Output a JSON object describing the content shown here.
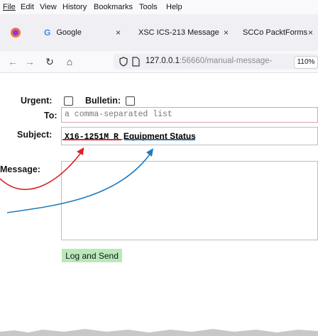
{
  "menu": {
    "file": "File",
    "edit": "Edit",
    "view": "View",
    "history": "History",
    "bookmarks": "Bookmarks",
    "tools": "Tools",
    "help": "Help"
  },
  "tabs": [
    {
      "label": "Google"
    },
    {
      "label": "XSC ICS-213 Message"
    },
    {
      "label": "SCCo PacktForms"
    }
  ],
  "url": {
    "host": "127.0.0.1",
    "rest": ":56660/manual-message-",
    "zoom": "110%"
  },
  "form": {
    "urgent_label": "Urgent:",
    "bulletin_label": "Bulletin:",
    "to_label": "To:",
    "to_placeholder": "a comma-separated list",
    "subject_label": "Subject:",
    "subject_code": "X16-1251M_R_",
    "subject_text": "Equipment Status",
    "message_label": "Message:",
    "send_label": "Log and Send"
  },
  "colors": {
    "red_arrow": "#d9242a",
    "blue_arrow": "#1f7bbf",
    "send_button": "#b9e9b9"
  }
}
